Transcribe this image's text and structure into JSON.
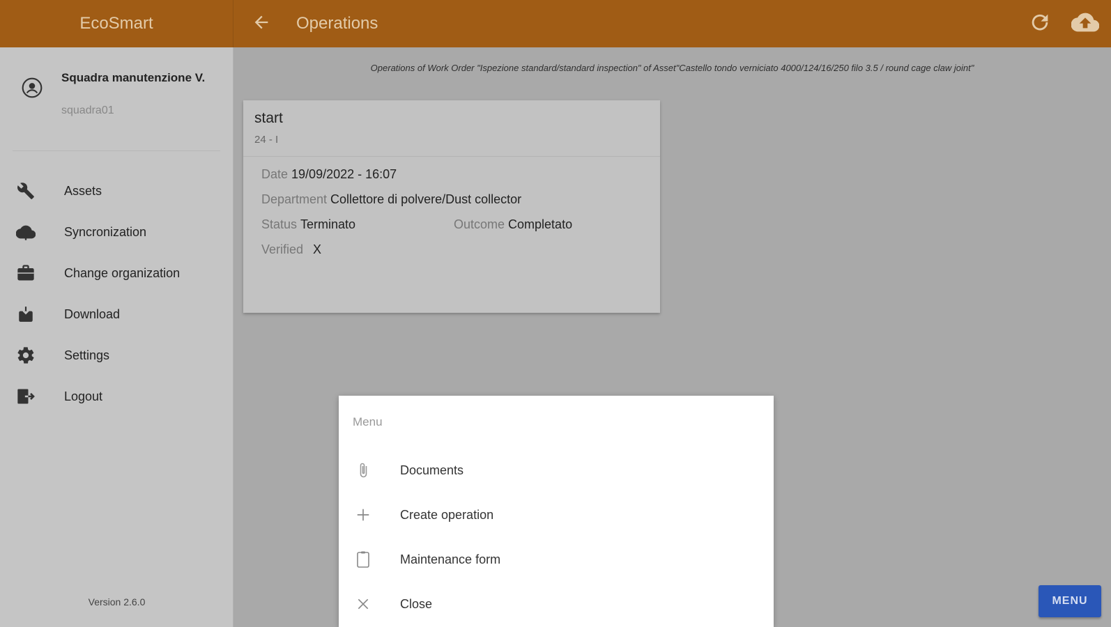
{
  "header": {
    "app_name": "EcoSmart",
    "title": "Operations",
    "icons": [
      "back-arrow-icon",
      "refresh-icon",
      "cloud-upload-icon"
    ]
  },
  "sidebar": {
    "user": {
      "name": "Squadra manutenzione V.",
      "login": "squadra01"
    },
    "items": [
      {
        "label": "Assets",
        "icon": "wrench-icon"
      },
      {
        "label": "Syncronization",
        "icon": "cloud-icon"
      },
      {
        "label": "Change organization",
        "icon": "briefcase-icon"
      },
      {
        "label": "Download",
        "icon": "download-box-icon"
      },
      {
        "label": "Settings",
        "icon": "gear-icon"
      },
      {
        "label": "Logout",
        "icon": "logout-icon"
      }
    ],
    "version": "Version 2.6.0"
  },
  "main": {
    "subtitle": "Operations of Work Order \"Ispezione standard/standard inspection\" of Asset\"Castello tondo verniciato 4000/124/16/250 filo 3.5 / round cage claw joint\"",
    "card": {
      "title": "start",
      "code": "24 - I",
      "date_label": "Date",
      "date_value": "19/09/2022 - 16:07",
      "department_label": "Department",
      "department_value": "Collettore di polvere/Dust collector",
      "status_label": "Status",
      "status_value": "Terminato",
      "outcome_label": "Outcome",
      "outcome_value": "Completato",
      "verified_label": "Verified",
      "verified_value": "X"
    }
  },
  "dialog": {
    "title": "Menu",
    "items": [
      {
        "label": "Documents",
        "icon": "paperclip-icon"
      },
      {
        "label": "Create operation",
        "icon": "plus-icon"
      },
      {
        "label": "Maintenance form",
        "icon": "clipboard-icon"
      },
      {
        "label": "Close",
        "icon": "close-icon"
      }
    ]
  },
  "fab": {
    "label": "MENU"
  },
  "colors": {
    "topbar": "#a05c15",
    "topbar_text": "#e3cba9",
    "fab": "#2a57b8",
    "overlay_main": "#a9a9a9",
    "overlay_sidebar": "#c5c5c5"
  }
}
